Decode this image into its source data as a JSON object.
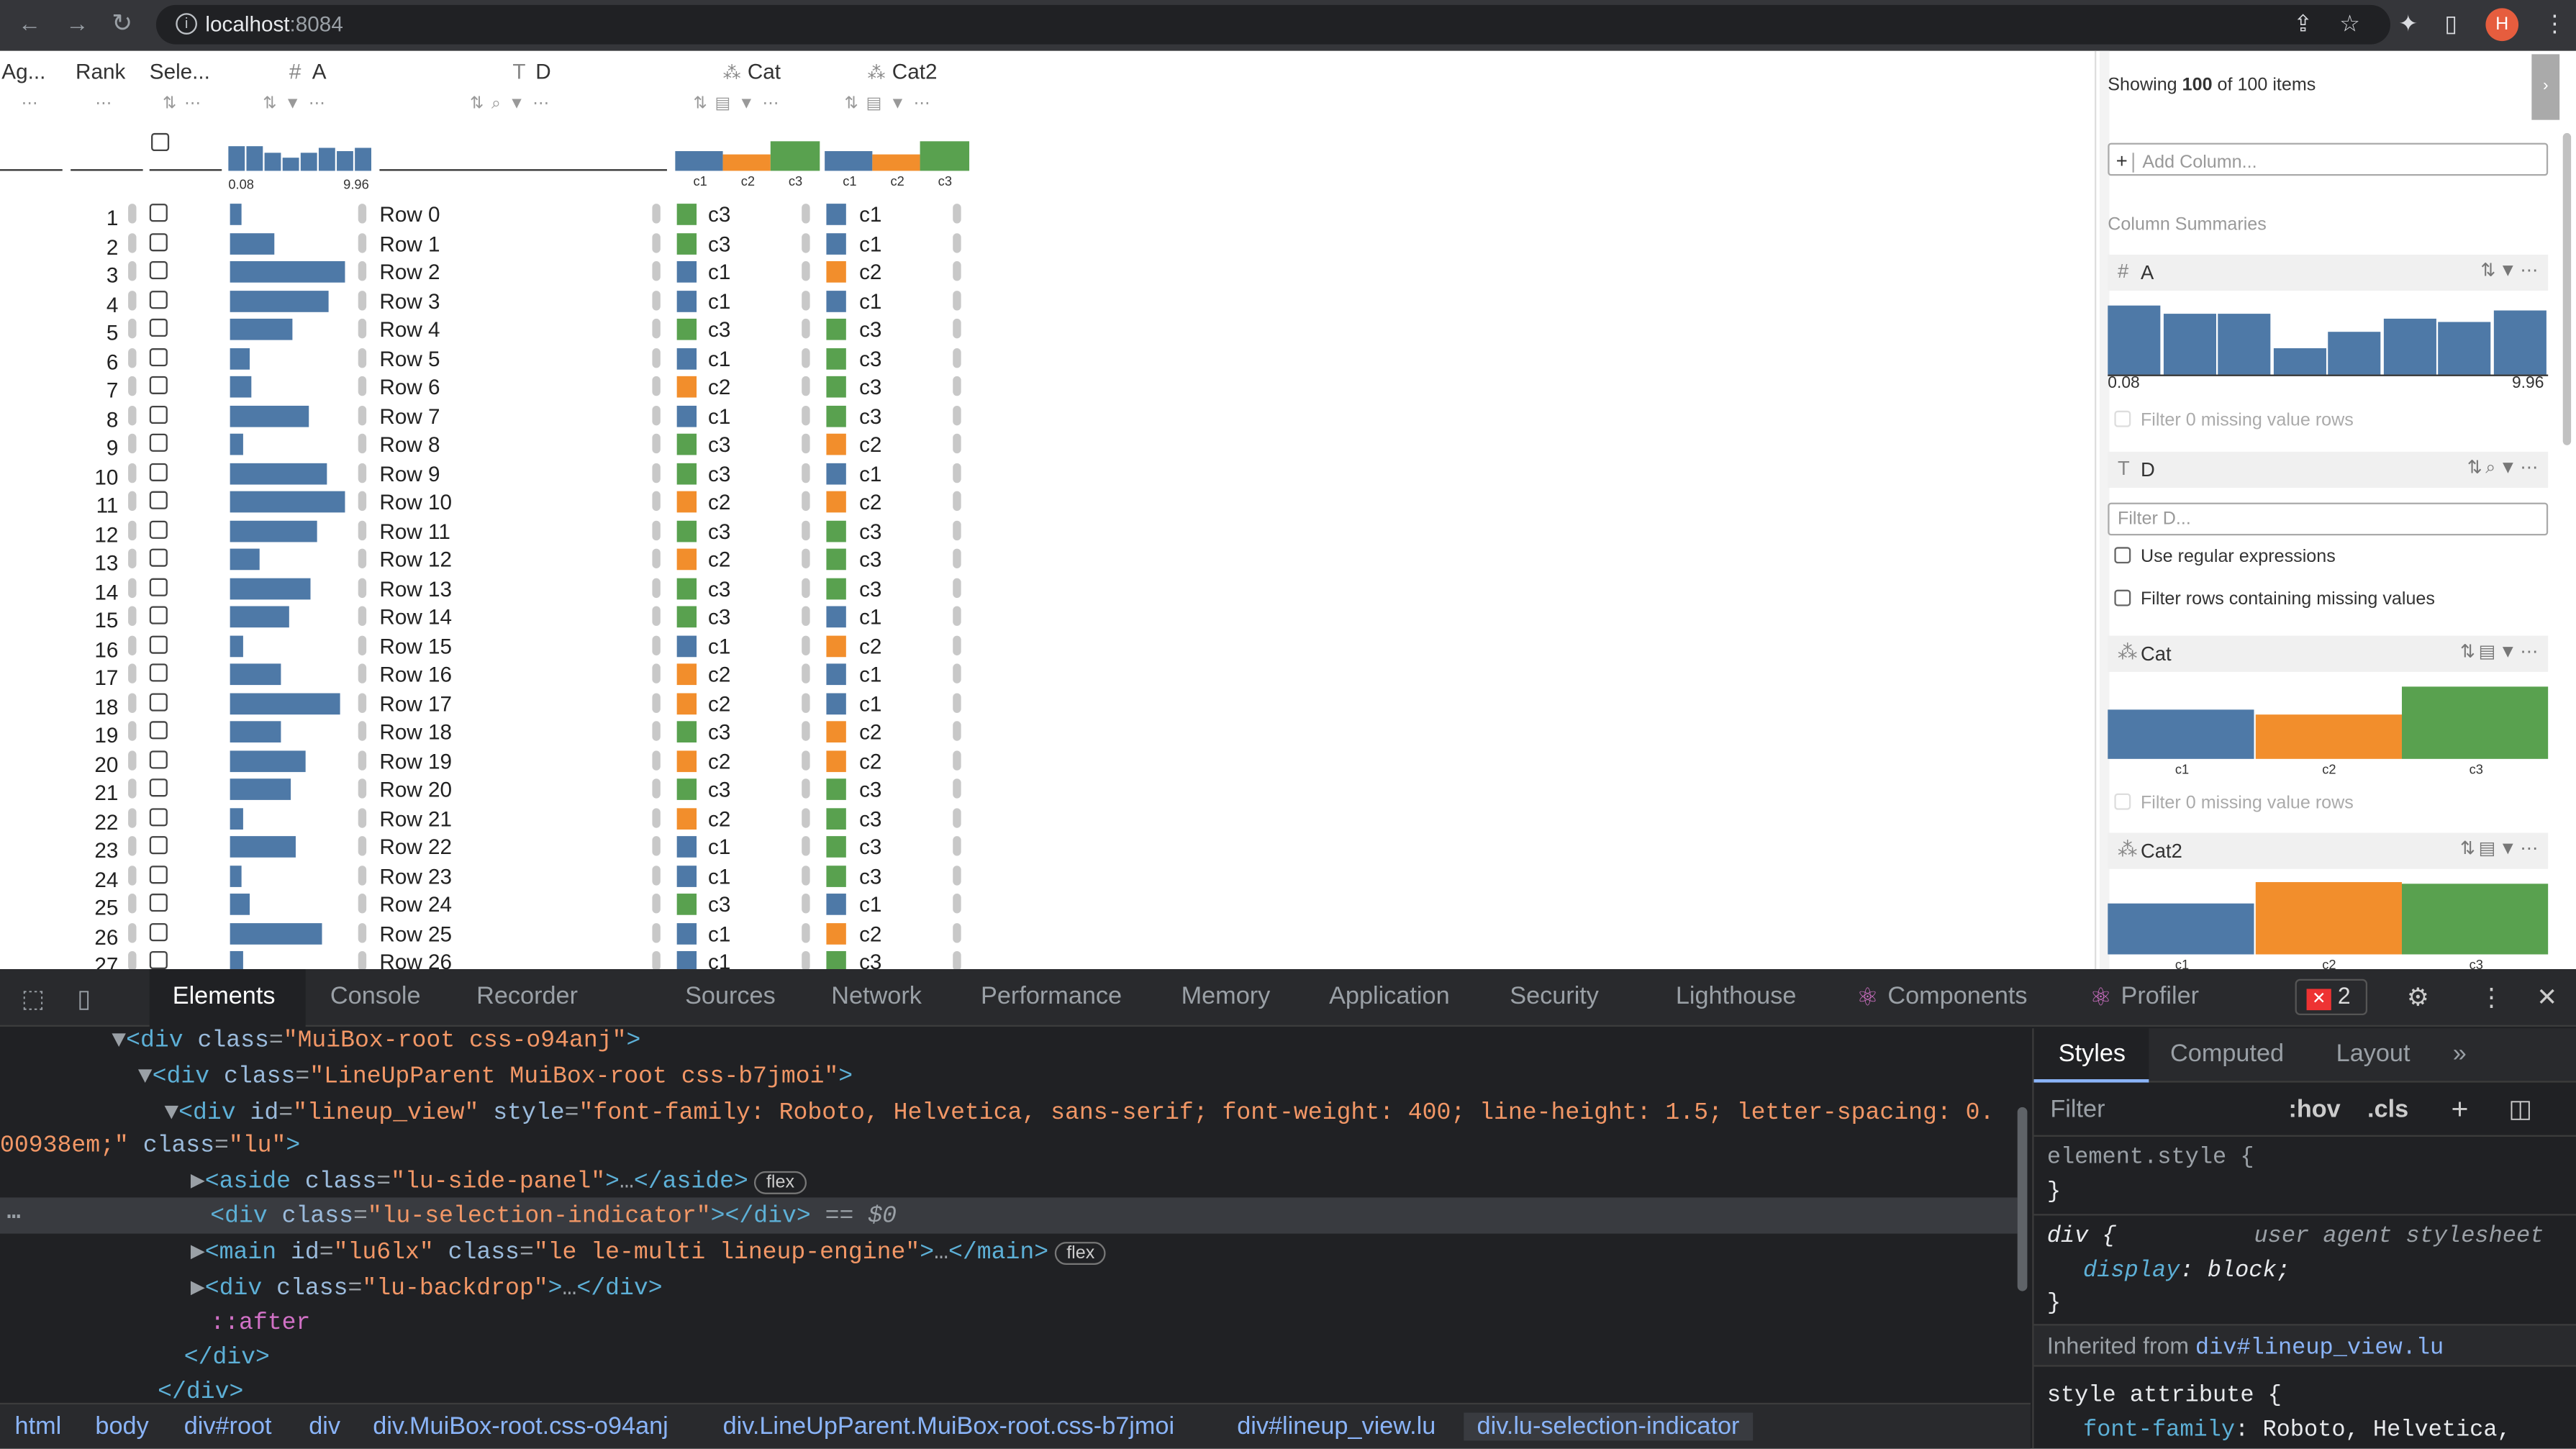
{
  "browser": {
    "url_host": "localhost",
    "url_port": ":8084",
    "avatar": "H",
    "back": "←",
    "forward": "→",
    "reload": "↻",
    "info": "i",
    "share": "⇪",
    "star": "☆",
    "ext": "✦",
    "sidebar": "▯"
  },
  "lineup": {
    "headers": {
      "agg": "Ag...",
      "rank": "Rank",
      "select": "Sele...",
      "a": "A",
      "a_icon": "#",
      "d": "D",
      "d_icon": "T",
      "cat": "Cat",
      "cat2": "Cat2"
    },
    "a_min": "0.08",
    "a_max": "9.96",
    "cat_labels": [
      "c1",
      "c2",
      "c3"
    ],
    "hist_a": [
      0.85,
      0.85,
      0.6,
      0.45,
      0.6,
      0.75,
      0.65,
      0.75
    ],
    "cat_dist": [
      0.33,
      0.33,
      0.34
    ],
    "cat2_dist": [
      0.33,
      0.33,
      0.34
    ],
    "colors": {
      "c1": "#4e79a7",
      "c2": "#f28e2c",
      "c3": "#59a14f"
    },
    "rows": [
      {
        "rank": "1",
        "a": 0.1,
        "d": "Row 0",
        "cat": "c3",
        "cat2": "c1"
      },
      {
        "rank": "2",
        "a": 0.38,
        "d": "Row 1",
        "cat": "c3",
        "cat2": "c1"
      },
      {
        "rank": "3",
        "a": 1.0,
        "d": "Row 2",
        "cat": "c1",
        "cat2": "c2"
      },
      {
        "rank": "4",
        "a": 0.86,
        "d": "Row 3",
        "cat": "c1",
        "cat2": "c1"
      },
      {
        "rank": "5",
        "a": 0.54,
        "d": "Row 4",
        "cat": "c3",
        "cat2": "c3"
      },
      {
        "rank": "6",
        "a": 0.17,
        "d": "Row 5",
        "cat": "c1",
        "cat2": "c3"
      },
      {
        "rank": "7",
        "a": 0.19,
        "d": "Row 6",
        "cat": "c2",
        "cat2": "c3"
      },
      {
        "rank": "8",
        "a": 0.68,
        "d": "Row 7",
        "cat": "c1",
        "cat2": "c3"
      },
      {
        "rank": "9",
        "a": 0.12,
        "d": "Row 8",
        "cat": "c3",
        "cat2": "c2"
      },
      {
        "rank": "10",
        "a": 0.84,
        "d": "Row 9",
        "cat": "c3",
        "cat2": "c1"
      },
      {
        "rank": "11",
        "a": 1.0,
        "d": "Row 10",
        "cat": "c2",
        "cat2": "c2"
      },
      {
        "rank": "12",
        "a": 0.75,
        "d": "Row 11",
        "cat": "c3",
        "cat2": "c3"
      },
      {
        "rank": "13",
        "a": 0.26,
        "d": "Row 12",
        "cat": "c2",
        "cat2": "c3"
      },
      {
        "rank": "14",
        "a": 0.7,
        "d": "Row 13",
        "cat": "c3",
        "cat2": "c3"
      },
      {
        "rank": "15",
        "a": 0.51,
        "d": "Row 14",
        "cat": "c3",
        "cat2": "c1"
      },
      {
        "rank": "16",
        "a": 0.12,
        "d": "Row 15",
        "cat": "c1",
        "cat2": "c2"
      },
      {
        "rank": "17",
        "a": 0.44,
        "d": "Row 16",
        "cat": "c2",
        "cat2": "c1"
      },
      {
        "rank": "18",
        "a": 0.96,
        "d": "Row 17",
        "cat": "c2",
        "cat2": "c1"
      },
      {
        "rank": "19",
        "a": 0.44,
        "d": "Row 18",
        "cat": "c3",
        "cat2": "c2"
      },
      {
        "rank": "20",
        "a": 0.66,
        "d": "Row 19",
        "cat": "c2",
        "cat2": "c2"
      },
      {
        "rank": "21",
        "a": 0.53,
        "d": "Row 20",
        "cat": "c3",
        "cat2": "c3"
      },
      {
        "rank": "22",
        "a": 0.12,
        "d": "Row 21",
        "cat": "c2",
        "cat2": "c3"
      },
      {
        "rank": "23",
        "a": 0.57,
        "d": "Row 22",
        "cat": "c1",
        "cat2": "c3"
      },
      {
        "rank": "24",
        "a": 0.1,
        "d": "Row 23",
        "cat": "c1",
        "cat2": "c3"
      },
      {
        "rank": "25",
        "a": 0.17,
        "d": "Row 24",
        "cat": "c3",
        "cat2": "c1"
      },
      {
        "rank": "26",
        "a": 0.8,
        "d": "Row 25",
        "cat": "c1",
        "cat2": "c2"
      },
      {
        "rank": "27",
        "a": 0.12,
        "d": "Row 26",
        "cat": "c1",
        "cat2": "c3"
      }
    ]
  },
  "side": {
    "showing_prefix": "Showing ",
    "showing_count": "100",
    "showing_suffix": " of 100 items",
    "add_column": "Add Column...",
    "plus": "+",
    "column_summaries": "Column Summaries",
    "a_title": "A",
    "a_min": "0.08",
    "a_max": "9.96",
    "a_hist": [
      0.95,
      0.83,
      0.83,
      0.37,
      0.6,
      0.78,
      0.73,
      0.88
    ],
    "filter_missing_a": "Filter 0 missing value rows",
    "d_title": "D",
    "filter_d": "Filter D...",
    "use_regex": "Use regular expressions",
    "filter_rows_missing": "Filter rows containing missing values",
    "cat_title": "Cat",
    "cat_hist": [
      0.68,
      0.62,
      1.0
    ],
    "filter_missing_cat": "Filter 0 missing value rows",
    "cat2_title": "Cat2",
    "cat2_hist": [
      0.7,
      1.0,
      0.98
    ],
    "cat_labels": [
      "c1",
      "c2",
      "c3"
    ]
  },
  "devtools": {
    "tabs": [
      "Elements",
      "Console",
      "Recorder",
      "Sources",
      "Network",
      "Performance",
      "Memory",
      "Application",
      "Security",
      "Lighthouse",
      "Components",
      "Profiler"
    ],
    "error_count": "2",
    "dom": {
      "l1_open": "<div class=",
      "l1_val": "\"MuiBox-root css-o94anj\"",
      "l2_val": "\"LineUpParent MuiBox-root css-b7jmoi\"",
      "l3_a": "<div id=",
      "l3_id": "\"lineup_view\"",
      "l3_b": " style=",
      "l3_style": "\"font-family: Roboto, Helvetica, sans-serif; font-weight: 400; line-height: 1.5; letter-spacing: 0.",
      "l3c_style": "00938em;\"",
      "l3c_class": " class=",
      "l3c_val": "\"lu\"",
      "aside": "\"lu-side-panel\"",
      "sel": "\"lu-selection-indicator\"",
      "sel_suffix": " == $0",
      "main_id": "\"lu6lx\"",
      "main_class": "\"le le-multi lineup-engine\"",
      "backdrop": "\"lu-backdrop\"",
      "after": "::after",
      "close_div": "</div>",
      "flex": "flex"
    },
    "crumbs": [
      "html",
      "body",
      "div#root",
      "div",
      "div.MuiBox-root.css-o94anj",
      "div.LineUpParent.MuiBox-root.css-b7jmoi",
      "div#lineup_view.lu",
      "div.lu-selection-indicator"
    ],
    "styles_tabs": [
      "Styles",
      "Computed",
      "Layout"
    ],
    "filter": "Filter",
    "hov": ":hov",
    "cls": ".cls",
    "element_style": "element.style {",
    "close_brace": "}",
    "div_rule": "div {",
    "ua": "user agent stylesheet",
    "display_prop": "display",
    "display_val": "block;",
    "inherited_prefix": "Inherited from ",
    "inherited_sel": "div#lineup_view.lu",
    "style_attr": "style attribute {",
    "ff_prop": "font-family",
    "ff_val": "Roboto, Helvetica,"
  }
}
